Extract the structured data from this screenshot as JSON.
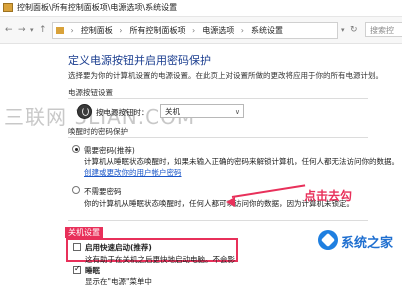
{
  "titlebar": {
    "path": "控制面板\\所有控制面板项\\电源选项\\系统设置"
  },
  "addressbar": {
    "crumbs": [
      "控制面板",
      "所有控制面板项",
      "电源选项",
      "系统设置"
    ],
    "search_placeholder": "搜索控"
  },
  "page": {
    "heading": "定义电源按钮并启用密码保护",
    "description": "选择要为你的计算机设置的电源设置。在此页上对设置所做的更改将应用于你的所有电源计划。",
    "watermark": "三联网 3LIAN.COM"
  },
  "power_button": {
    "section": "电源按钮设置",
    "label": "按电源按钮时：",
    "value": "关机"
  },
  "password": {
    "section": "唤醒时的密码保护",
    "require": {
      "label": "需要密码(推荐)",
      "desc": "计算机从睡眠状态唤醒时，如果未输入正确的密码来解锁计算机，任何人都无法访问你的数据。",
      "link": "创建或更改你的用户帐户密码"
    },
    "norequire": {
      "label": "不需要密码",
      "desc": "你的计算机从睡眠状态唤醒时，任何人都可以访问你的数据，因为计算机未锁定。"
    }
  },
  "shutdown": {
    "section": "关机设置",
    "fast_startup": {
      "label": "启用快速启动(推荐)",
      "desc": "这有助于在关机之后更快地启动电脑。不会影"
    },
    "sleep": {
      "label": "睡眠"
    },
    "partial": "显示在\"电源\"菜单中"
  },
  "annotation": {
    "callout": "点击去勾"
  },
  "logo": {
    "text": "系统之家"
  }
}
